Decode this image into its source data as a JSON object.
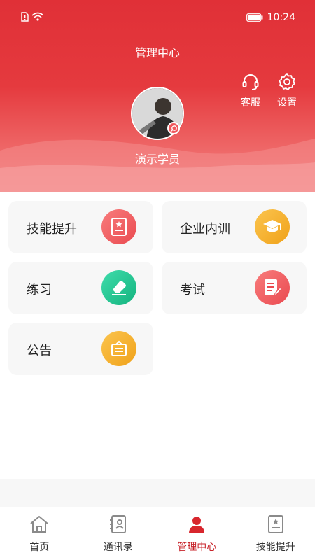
{
  "status_bar": {
    "time": "10:24"
  },
  "header": {
    "title": "管理中心",
    "service_label": "客服",
    "settings_label": "设置",
    "username": "演示学员"
  },
  "cards": [
    {
      "label": "技能提升",
      "icon": "certificate-icon",
      "color": "#f0575c"
    },
    {
      "label": "企业内训",
      "icon": "graduation-cap-icon",
      "color": "#f2a922"
    },
    {
      "label": "练习",
      "icon": "eraser-icon",
      "color": "#1ec48f"
    },
    {
      "label": "考试",
      "icon": "exam-paper-icon",
      "color": "#f0575c"
    },
    {
      "label": "公告",
      "icon": "notice-board-icon",
      "color": "#f2a922"
    }
  ],
  "tabbar": {
    "items": [
      {
        "label": "首页",
        "icon": "home-icon"
      },
      {
        "label": "通讯录",
        "icon": "contacts-icon"
      },
      {
        "label": "管理中心",
        "icon": "user-icon",
        "active": true
      },
      {
        "label": "技能提升",
        "icon": "certificate-icon"
      }
    ]
  },
  "colors": {
    "brand_red": "#e03037",
    "active_tab": "#c8242b"
  }
}
